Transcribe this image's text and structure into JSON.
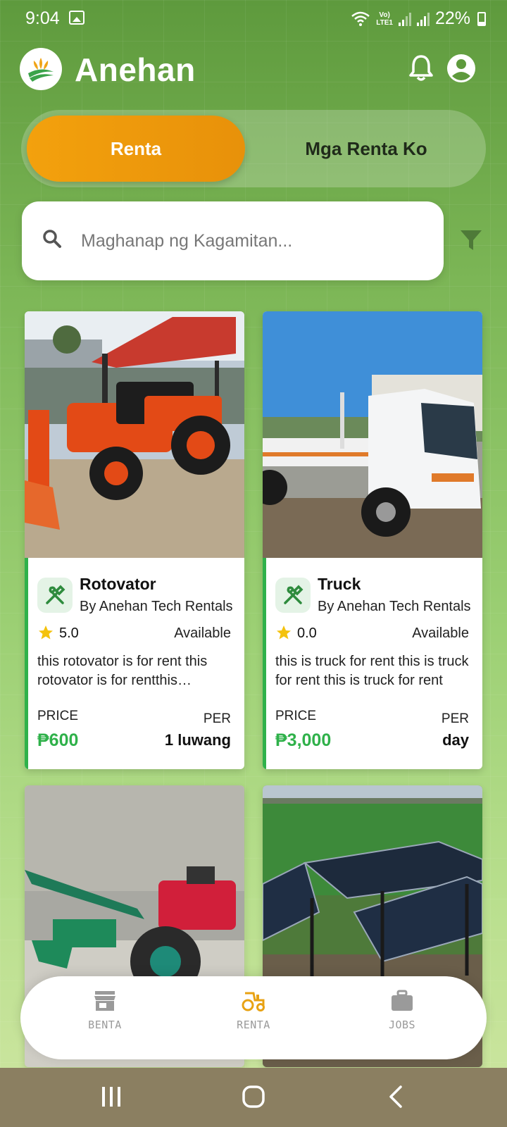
{
  "status_bar": {
    "time": "9:04",
    "lte": "Vo)\nLTE1",
    "battery": "22%"
  },
  "header": {
    "title": "Anehan"
  },
  "tabs": [
    {
      "label": "Renta",
      "active": true
    },
    {
      "label": "Mga Renta Ko",
      "active": false
    }
  ],
  "search": {
    "placeholder": "Maghanap ng Kagamitan..."
  },
  "listings": [
    {
      "name": "Rotovator",
      "owner": "By Anehan Tech Rentals",
      "rating": "5.0",
      "status": "Available",
      "description": "this rotovator is for rent this rotovator is for rentthis rotovator is for rent",
      "price_label": "PRICE",
      "price": "₱600",
      "per_label": "PER",
      "per": "1 luwang"
    },
    {
      "name": "Truck",
      "owner": "By Anehan Tech Rentals",
      "rating": "0.0",
      "status": "Available",
      "description": "this is truck for rent this is truck for rent this is truck for rent",
      "price_label": "PRICE",
      "price": "₱3,000",
      "per_label": "PER",
      "per": "day"
    }
  ],
  "bottom_nav": [
    {
      "label": "BENTA",
      "icon": "store-icon",
      "active": false
    },
    {
      "label": "RENTA",
      "icon": "tractor-icon",
      "active": true
    },
    {
      "label": "JOBS",
      "icon": "briefcase-icon",
      "active": false
    }
  ],
  "colors": {
    "accent_orange": "#f3a10d",
    "price_green": "#2fb14a",
    "nav_active": "#e8a213"
  }
}
